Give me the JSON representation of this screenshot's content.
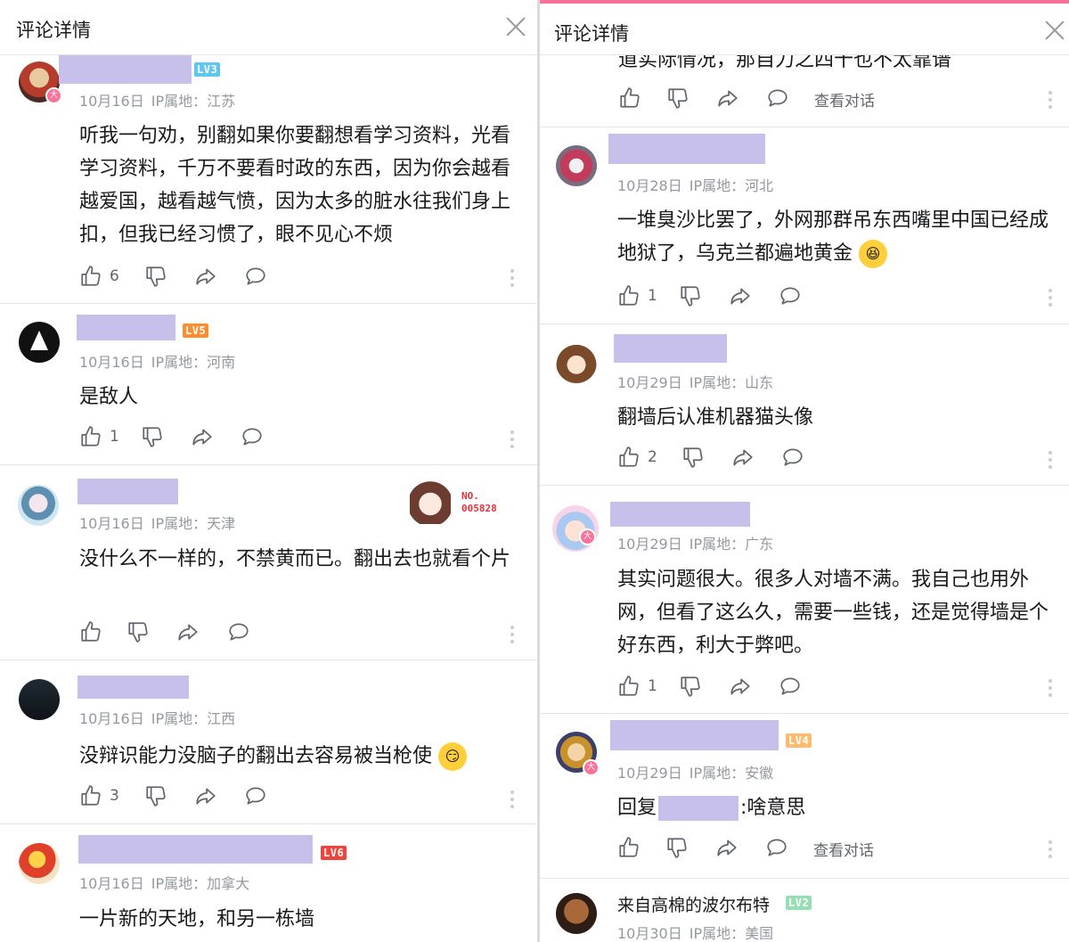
{
  "header": {
    "title": "评论详情"
  },
  "colors": {
    "accent": "#fb7299",
    "redacted": "#c7c0ea",
    "meta": "#9499a0"
  },
  "actions": {
    "view_dialog": "查看对话"
  },
  "left": {
    "comments": [
      {
        "level": "LV3",
        "meta_date": "10月16日",
        "meta_ip": "IP属地：江苏",
        "badge": "大",
        "content": "听我一句劝，别翻如果你要翻想看学习资料，光看学习资料，千万不要看时政的东西，因为你会越看越爱国，越看越气愤，因为太多的脏水往我们身上扣，但我已经习惯了，眼不见心不烦",
        "likes": "6"
      },
      {
        "level": "LV5",
        "meta_date": "10月16日",
        "meta_ip": "IP属地：河南",
        "content": "是敌人",
        "likes": "1"
      },
      {
        "meta_date": "10月16日",
        "meta_ip": "IP属地：天津",
        "card_no_label": "NO.",
        "card_no": "005828",
        "content": "没什么不一样的，不禁黄而已。翻出去也就看个片",
        "likes": ""
      },
      {
        "meta_date": "10月16日",
        "meta_ip": "IP属地：江西",
        "content": "没辩识能力没脑子的翻出去容易被当枪使",
        "likes": "3"
      },
      {
        "level": "LV6",
        "meta_date": "10月16日",
        "meta_ip": "IP属地：加拿大",
        "content": "一片新的天地，和另一栋墙"
      }
    ]
  },
  "right": {
    "top_partial_text": "道实际情况，那自力之四十也不太靠谱",
    "comments": [
      {
        "meta_date": "10月28日",
        "meta_ip": "IP属地：河北",
        "content": "一堆臭沙比罢了，外网那群吊东西嘴里中国已经成地狱了，乌克兰都遍地黄金",
        "likes": "1"
      },
      {
        "meta_date": "10月29日",
        "meta_ip": "IP属地：山东",
        "content": "翻墙后认准机器猫头像",
        "likes": "2"
      },
      {
        "meta_date": "10月29日",
        "meta_ip": "IP属地：广东",
        "badge": "大",
        "content": "其实问题很大。很多人对墙不满。我自己也用外网，但看了这么久，需要一些钱，还是觉得墙是个好东西，利大于弊吧。",
        "likes": "1"
      },
      {
        "level": "LV4",
        "meta_date": "10月29日",
        "meta_ip": "IP属地：安徽",
        "badge": "大",
        "reply_prefix": "回复",
        "reply_suffix": ":啥意思"
      },
      {
        "name": "来自高棉的波尔布特",
        "level": "LV2",
        "meta_date": "10月30日",
        "meta_ip": "IP属地：美国"
      }
    ]
  }
}
